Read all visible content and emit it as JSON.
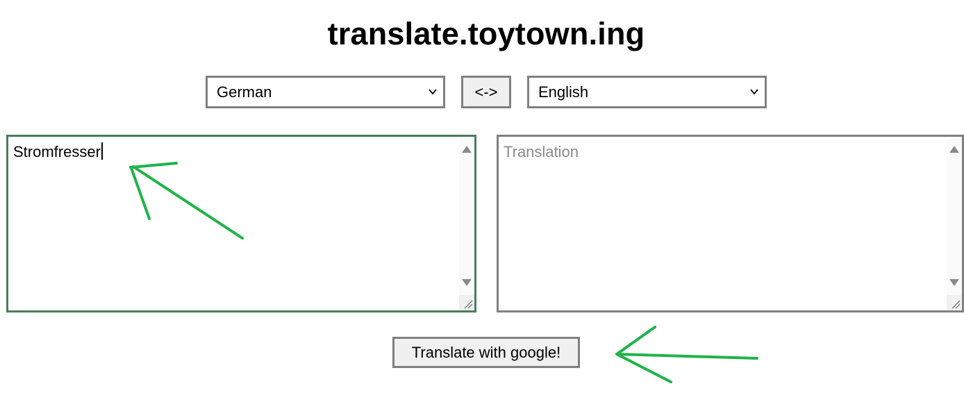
{
  "site": {
    "title": "translate.toytown.ing"
  },
  "languages": {
    "source": "German",
    "target": "English",
    "swap_label": "<->"
  },
  "source_box": {
    "value": "Stromfresser"
  },
  "target_box": {
    "placeholder": "Translation"
  },
  "actions": {
    "translate_label": "Translate with google!"
  },
  "colors": {
    "annotation_green": "#1fb34a",
    "focus_border": "#4a7c5c",
    "border_gray": "#808080",
    "button_bg": "#f0f0f0"
  },
  "icons": {
    "select_arrow": "chevron-down-icon",
    "scroll_up": "triangle-up-icon",
    "scroll_down": "triangle-down-icon",
    "resize": "resize-grip-icon",
    "annotation": "arrow-annotation"
  }
}
